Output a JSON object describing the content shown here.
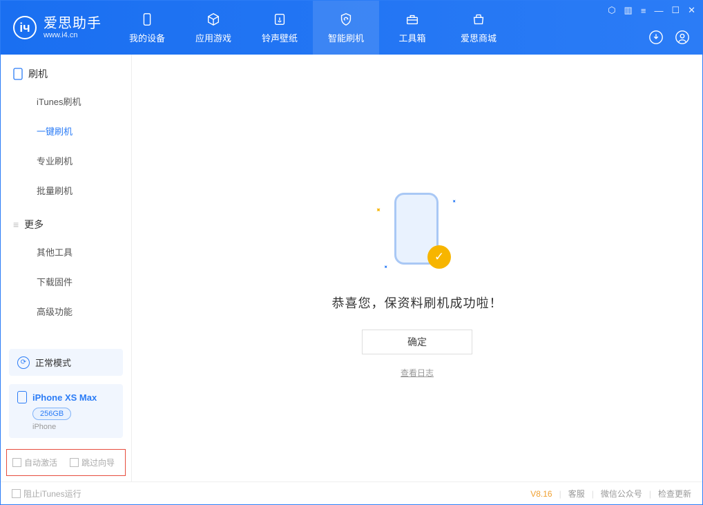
{
  "app": {
    "name_cn": "爱思助手",
    "name_en": "www.i4.cn"
  },
  "nav": [
    {
      "label": "我的设备"
    },
    {
      "label": "应用游戏"
    },
    {
      "label": "铃声壁纸"
    },
    {
      "label": "智能刷机"
    },
    {
      "label": "工具箱"
    },
    {
      "label": "爱思商城"
    }
  ],
  "sidebar": {
    "section1": {
      "title": "刷机",
      "items": [
        "iTunes刷机",
        "一键刷机",
        "专业刷机",
        "批量刷机"
      ],
      "active_index": 1
    },
    "section2": {
      "title": "更多",
      "items": [
        "其他工具",
        "下载固件",
        "高级功能"
      ]
    }
  },
  "mode": {
    "label": "正常模式"
  },
  "device": {
    "name": "iPhone XS Max",
    "storage": "256GB",
    "type": "iPhone"
  },
  "options": {
    "auto_activate": "自动激活",
    "skip_guide": "跳过向导"
  },
  "main": {
    "success_text": "恭喜您，保资料刷机成功啦！",
    "ok_label": "确定",
    "view_log": "查看日志"
  },
  "footer": {
    "block_itunes": "阻止iTunes运行",
    "version": "V8.16",
    "links": [
      "客服",
      "微信公众号",
      "检查更新"
    ]
  }
}
